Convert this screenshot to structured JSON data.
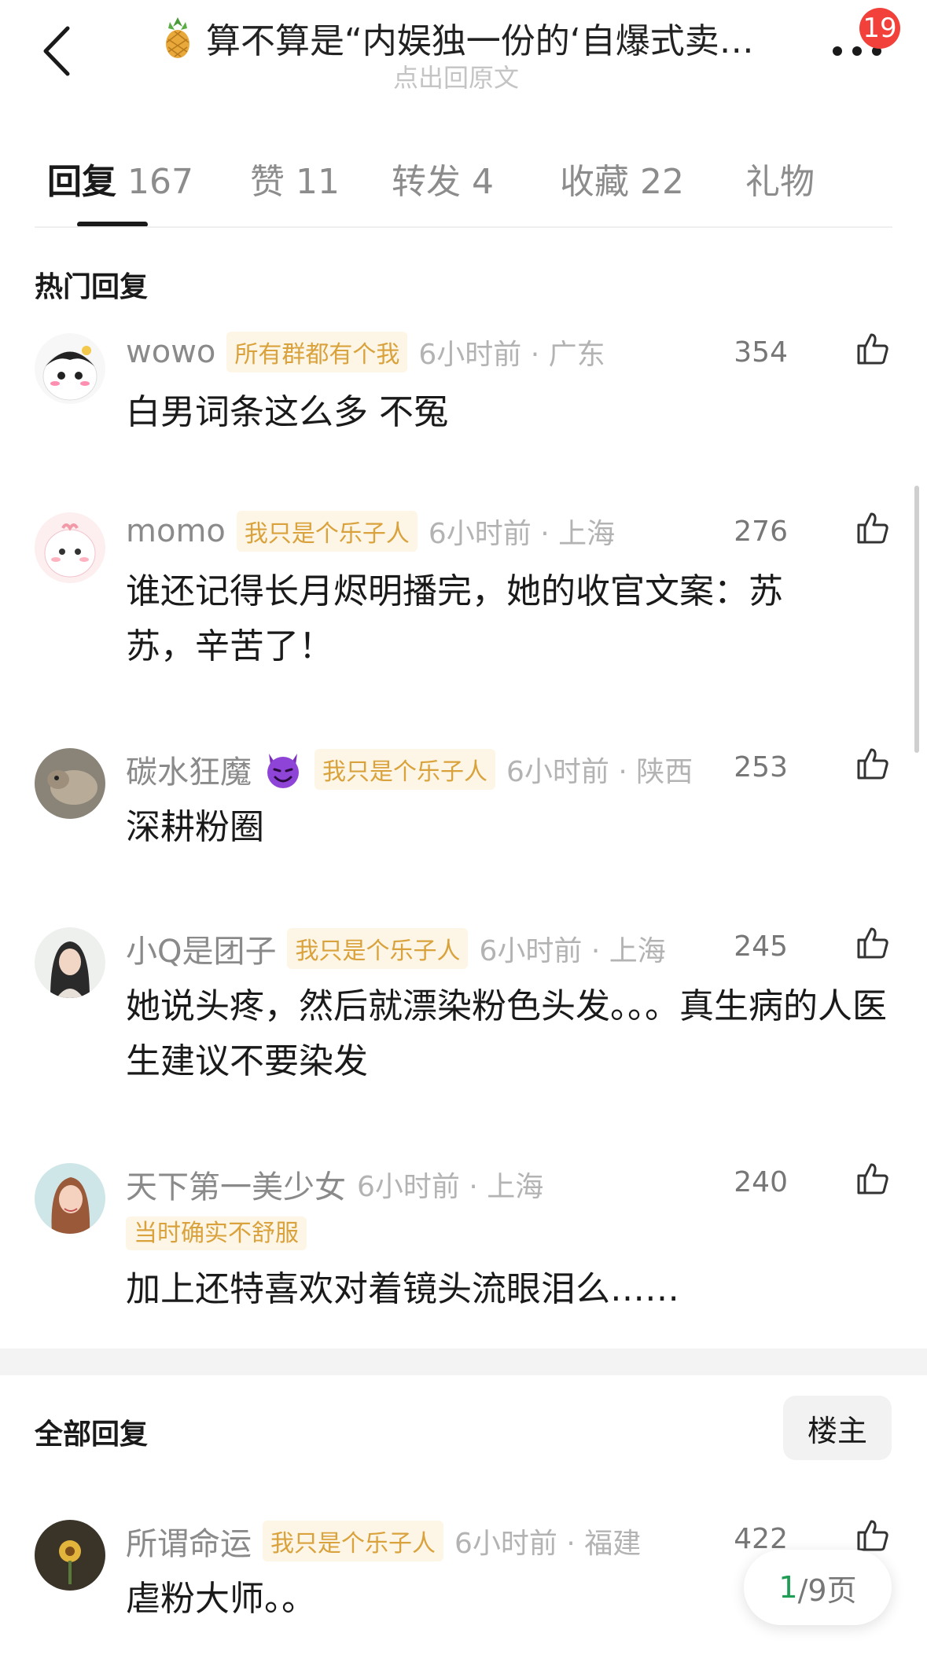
{
  "header": {
    "title": "算不算是“内娱独一份的‘自爆式卖…",
    "subtitle": "点出回原文",
    "notification_count": "19"
  },
  "tabs": [
    {
      "label": "回复",
      "count": "167"
    },
    {
      "label": "赞",
      "count": "11"
    },
    {
      "label": "转发",
      "count": "4"
    },
    {
      "label": "收藏",
      "count": "22"
    },
    {
      "label": "礼物",
      "count": ""
    }
  ],
  "hot_replies": {
    "title": "热门回复",
    "items": [
      {
        "name": "wowo",
        "tag": "所有群都有个我",
        "meta": "6小时前 · 广东",
        "likes": "354",
        "text": "白男词条这么多 不冤"
      },
      {
        "name": "momo",
        "tag": "我只是个乐子人",
        "meta": "6小时前 · 上海",
        "likes": "276",
        "text": "谁还记得长月烬明播完，她的收官文案：苏苏，辛苦了！"
      },
      {
        "name": "碳水狂魔",
        "tag": "我只是个乐子人",
        "meta": "6小时前 · 陕西",
        "likes": "253",
        "text": "深耕粉圈"
      },
      {
        "name": "小Q是团子",
        "tag": "我只是个乐子人",
        "meta": "6小时前 · 上海",
        "likes": "245",
        "text": "她说头疼，然后就漂染粉色头发。。。真生病的人医生建议不要染发"
      },
      {
        "name": "天下第一美少女",
        "tag": "当时确实不舒服",
        "meta": "6小时前 · 上海",
        "likes": "240",
        "text": "加上还特喜欢对着镜头流眼泪么……"
      }
    ]
  },
  "all_replies": {
    "title": "全部回复",
    "owner_button": "楼主",
    "items": [
      {
        "name": "所谓命运",
        "tag": "我只是个乐子人",
        "meta": "6小时前 · 福建",
        "likes": "422",
        "text": "虐粉大师。。"
      }
    ]
  },
  "pagination": {
    "current": "1",
    "total_text": "/9页"
  },
  "colors": {
    "tag_text": "#d9a23c",
    "tag_bg": "#fdf6e6",
    "badge": "#f2413b",
    "page_current": "#1f9d55"
  }
}
